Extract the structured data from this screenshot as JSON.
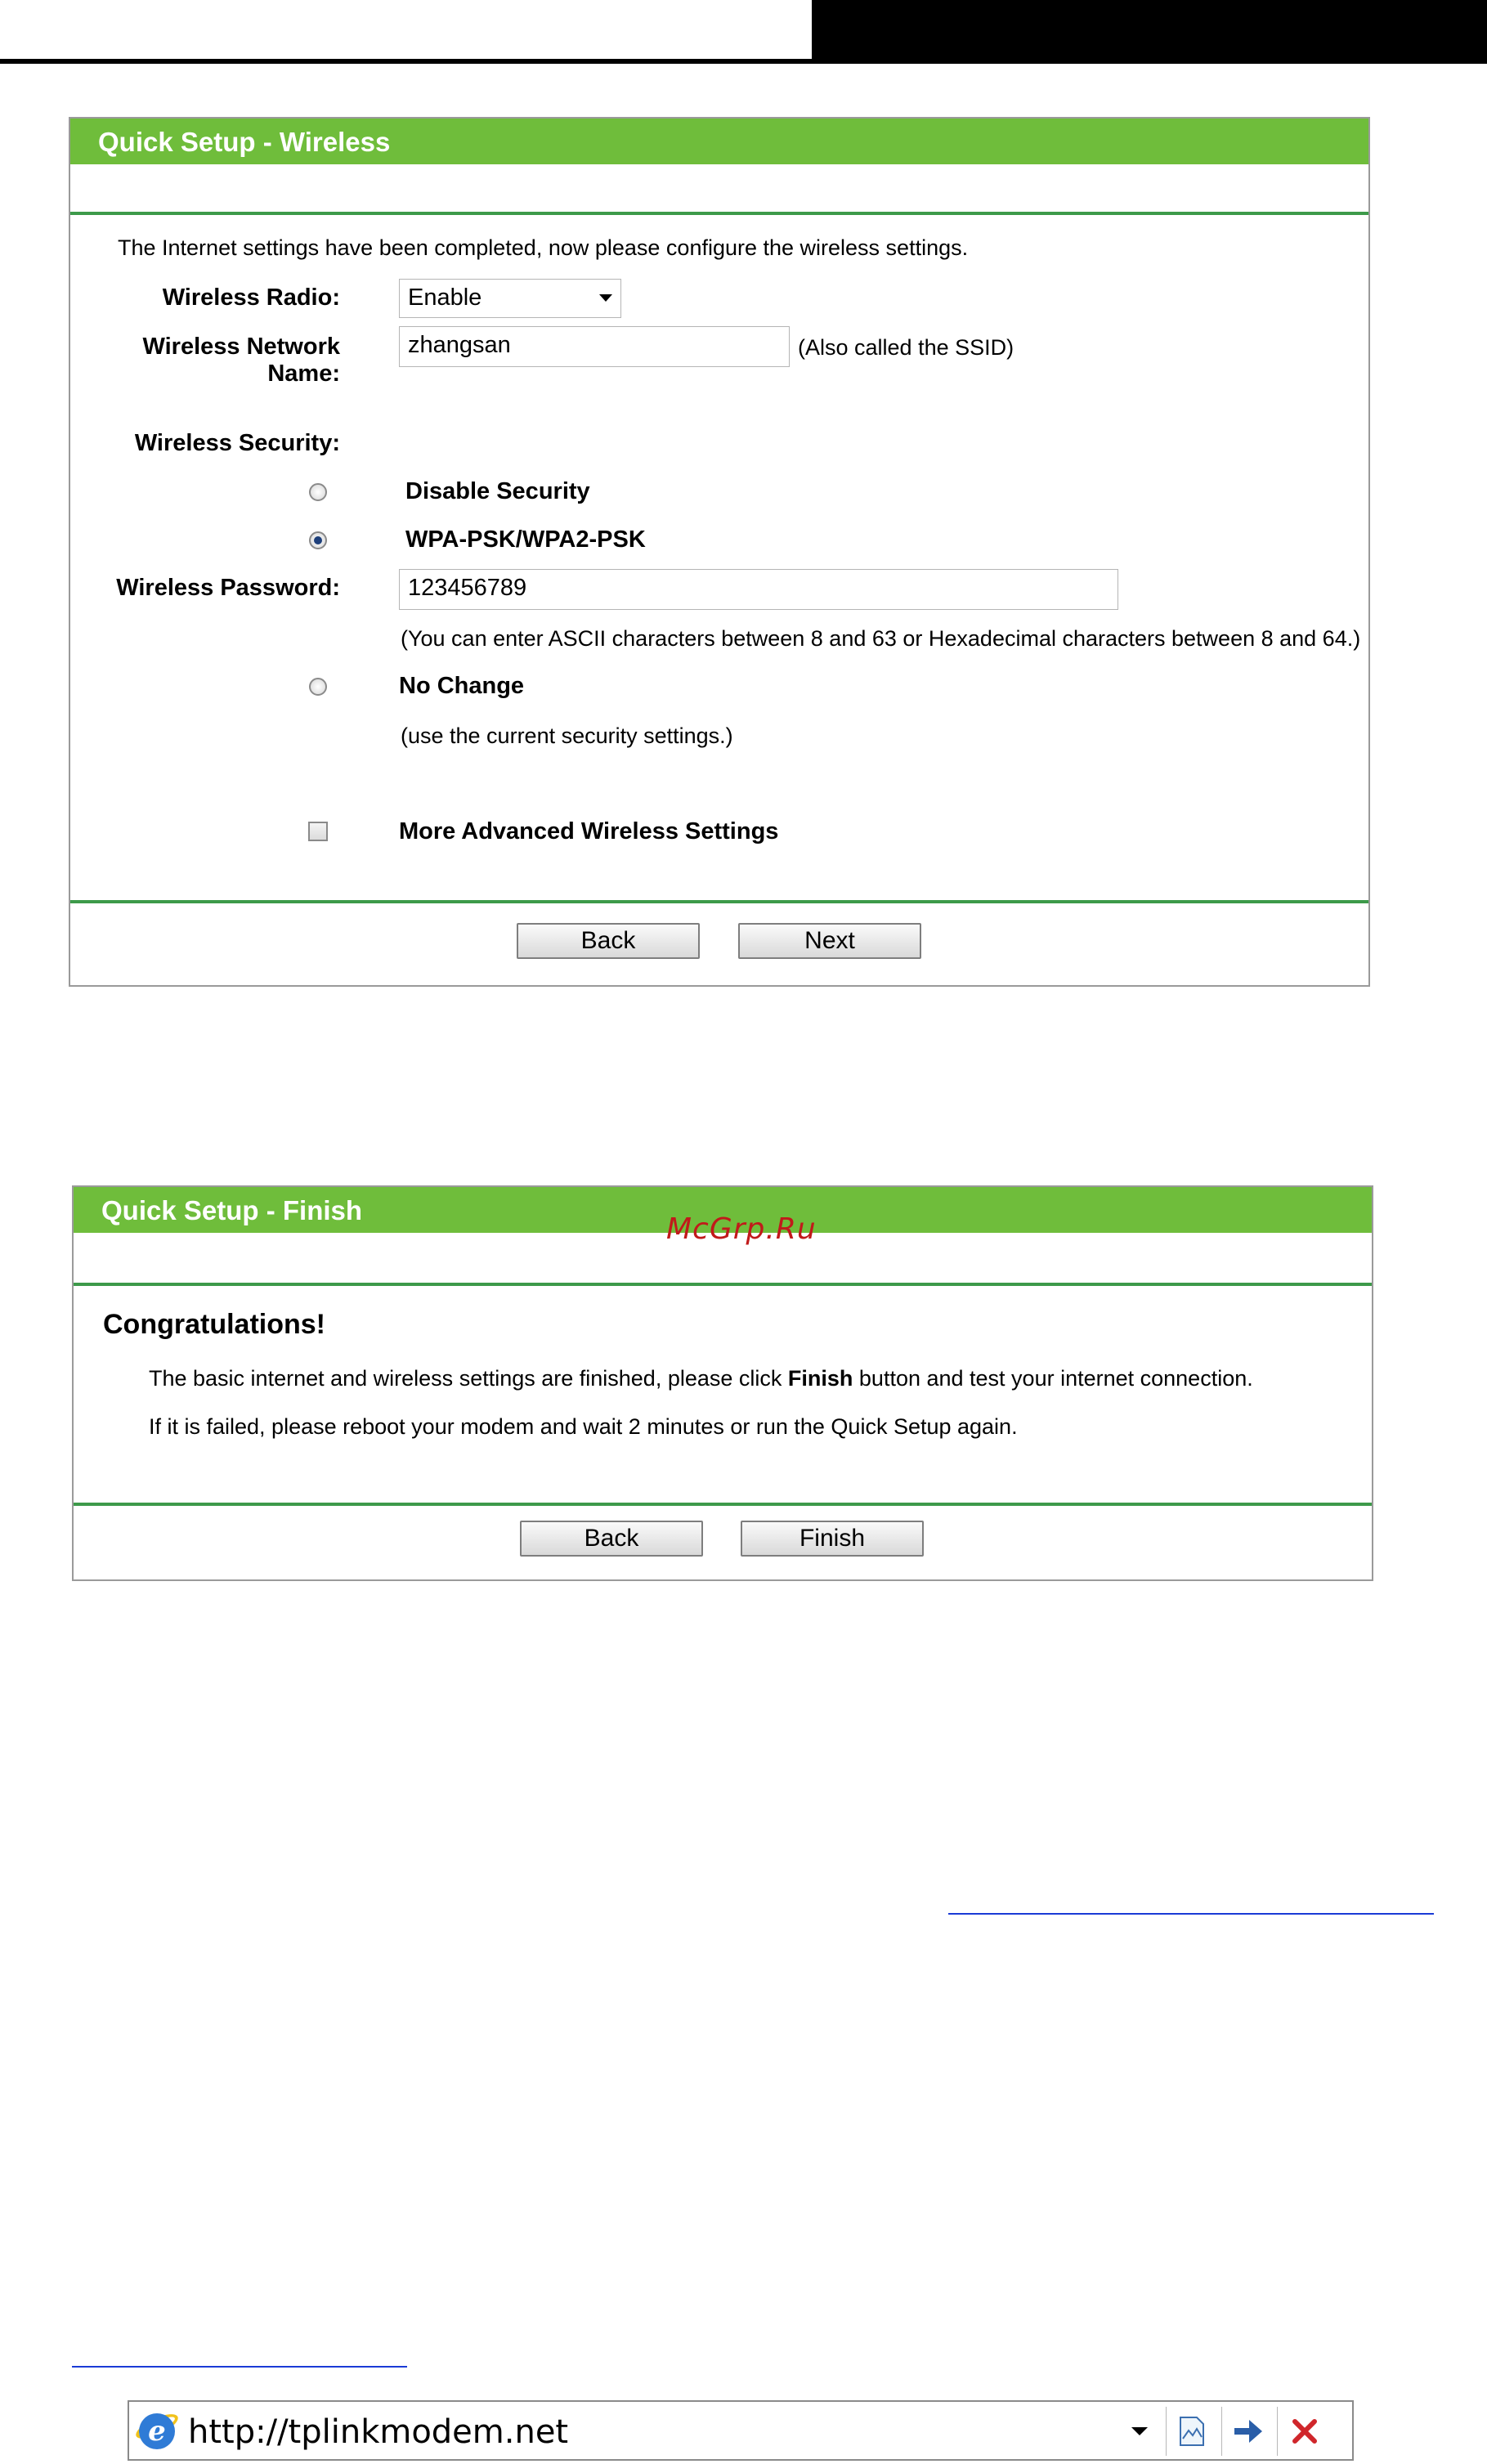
{
  "wireless_panel": {
    "title": "Quick Setup - Wireless",
    "intro": "The Internet settings have been completed, now please configure the wireless settings.",
    "radio_label": "Wireless Radio:",
    "radio_value": "Enable",
    "ssid_label": "Wireless Network Name:",
    "ssid_value": "zhangsan",
    "ssid_note": "(Also called the SSID)",
    "security_label": "Wireless Security:",
    "option_disable": "Disable Security",
    "option_wpa": "WPA-PSK/WPA2-PSK",
    "password_label": "Wireless Password:",
    "password_value": "123456789",
    "password_note": "(You can enter ASCII characters between 8 and 63 or Hexadecimal characters between 8 and 64.)",
    "option_nochange": "No Change",
    "nochange_note": "(use the current security settings.)",
    "advanced_label": "More Advanced Wireless Settings",
    "back_label": "Back",
    "next_label": "Next"
  },
  "finish_panel": {
    "title": "Quick Setup - Finish",
    "congrats": "Congratulations!",
    "line1_before": "The basic internet and wireless settings are finished, please click ",
    "line1_bold": "Finish",
    "line1_after": " button and test your internet connection.",
    "line2": "If it is failed, please reboot your modem and wait 2 minutes or run the Quick Setup again.",
    "back_label": "Back",
    "finish_label": "Finish"
  },
  "watermark": "McGrp.Ru",
  "address_bar": {
    "url": "http://tplinkmodem.net",
    "icon_browser": "ie-icon",
    "icon_compat": "compatibility-view-icon",
    "icon_go": "go-arrow-icon",
    "icon_stop": "stop-icon"
  },
  "colors": {
    "header_green": "#6fbd3b",
    "rule_green": "#3d9a4a",
    "link_blue": "#1a3bd6",
    "watermark_red": "#c11a1a"
  }
}
